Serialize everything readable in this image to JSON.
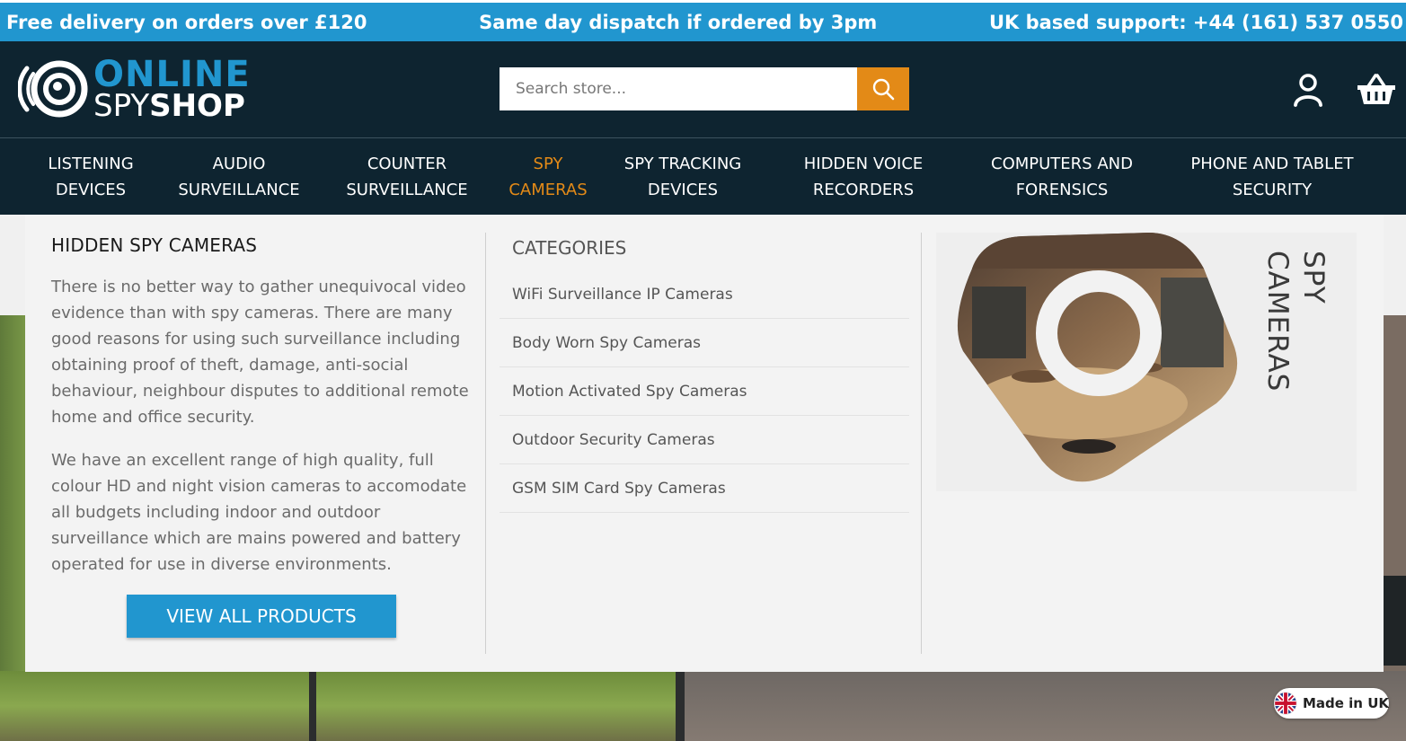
{
  "topbar": {
    "left": "Free delivery on orders over £120",
    "center": "Same day dispatch if ordered by 3pm",
    "right": "UK based support: +44 (161) 537 0550"
  },
  "logo": {
    "line1": "ONLINE",
    "line2_light": "SPY",
    "line2_bold": "SHOP",
    "icon": "eye-lens-logo-icon"
  },
  "search": {
    "placeholder": "Search store...",
    "button_icon": "search-icon"
  },
  "header_icons": [
    "account-icon",
    "basket-icon"
  ],
  "nav": {
    "items": [
      {
        "line1": "LISTENING",
        "line2": "DEVICES"
      },
      {
        "line1": "AUDIO",
        "line2": "SURVEILLANCE"
      },
      {
        "line1": "COUNTER",
        "line2": "SURVEILLANCE"
      },
      {
        "line1": "SPY",
        "line2": "CAMERAS"
      },
      {
        "line1": "SPY TRACKING",
        "line2": "DEVICES"
      },
      {
        "line1": "HIDDEN VOICE",
        "line2": "RECORDERS"
      },
      {
        "line1": "COMPUTERS AND",
        "line2": "FORENSICS"
      },
      {
        "line1": "PHONE AND TABLET",
        "line2": "SECURITY"
      }
    ],
    "active_index": 3
  },
  "mega": {
    "title": "HIDDEN SPY CAMERAS",
    "para1": "There is no better way to gather unequivocal video evidence than with spy cameras. There are many good reasons for using such surveillance including obtaining proof of theft, damage, anti-social behaviour, neighbour disputes to additional remote home and office security.",
    "para2": "We have an excellent range of high quality, full colour HD and night vision cameras to accomodate all budgets including indoor and outdoor surveillance which are mains powered and battery operated for use in diverse environments.",
    "button": "VIEW ALL PRODUCTS",
    "categories_heading": "CATEGORIES",
    "categories": [
      "WiFi Surveillance IP Cameras",
      "Body Worn Spy Cameras",
      "Motion Activated Spy Cameras",
      "Outdoor Security Cameras",
      "GSM SIM Card Spy Cameras"
    ],
    "promo_text": "SPY CAMERAS"
  },
  "badge": {
    "label": "Made in UK",
    "icon": "uk-flag-icon"
  },
  "colors": {
    "brand_blue": "#2196cf",
    "header_dark": "#0e2430",
    "accent_orange": "#e38a17",
    "panel_bg": "#f3f3f3"
  }
}
